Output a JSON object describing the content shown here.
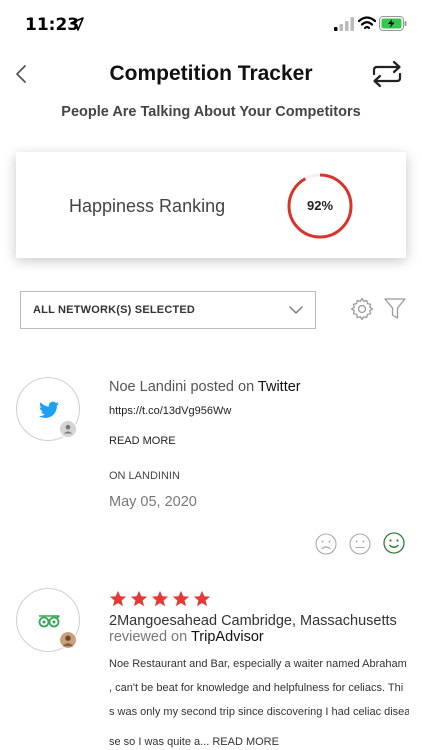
{
  "status_bar": {
    "time": "11:23"
  },
  "header": {
    "title": "Competition Tracker",
    "subtitle": "People Are Talking About Your Competitors"
  },
  "happiness": {
    "label": "Happiness Ranking",
    "value": "92%",
    "fraction": 0.92,
    "color": "#d9342b"
  },
  "filter": {
    "network_label": "ALL NETWORK(S) SELECTED"
  },
  "posts": [
    {
      "author": "Noe Landini",
      "verb": "posted on",
      "network": "Twitter",
      "url": "https://t.co/13dVg956Ww",
      "read_more": "READ MORE",
      "on_label": "ON LANDININ",
      "date": "May 05, 2020",
      "icon": "twitter-icon"
    },
    {
      "rating": 5,
      "author": "2Mangoesahead Cambridge, Massachusetts",
      "verb": "reviewed on",
      "network": "TripAdvisor",
      "text_lines": [
        "Noe Restaurant and Bar, especially a waiter named Abraham",
        ", can't be beat for knowledge and helpfulness for celiacs. Thi",
        "s was only my second trip since discovering I had celiac disea",
        "se so I was quite a..."
      ],
      "read_more": "READ MORE",
      "icon": "tripadvisor-icon"
    }
  ],
  "colors": {
    "accent_green": "#2e7d32",
    "star_red": "#e53935",
    "twitter_blue": "#1da1f2",
    "tripadvisor_green": "#34a853"
  }
}
